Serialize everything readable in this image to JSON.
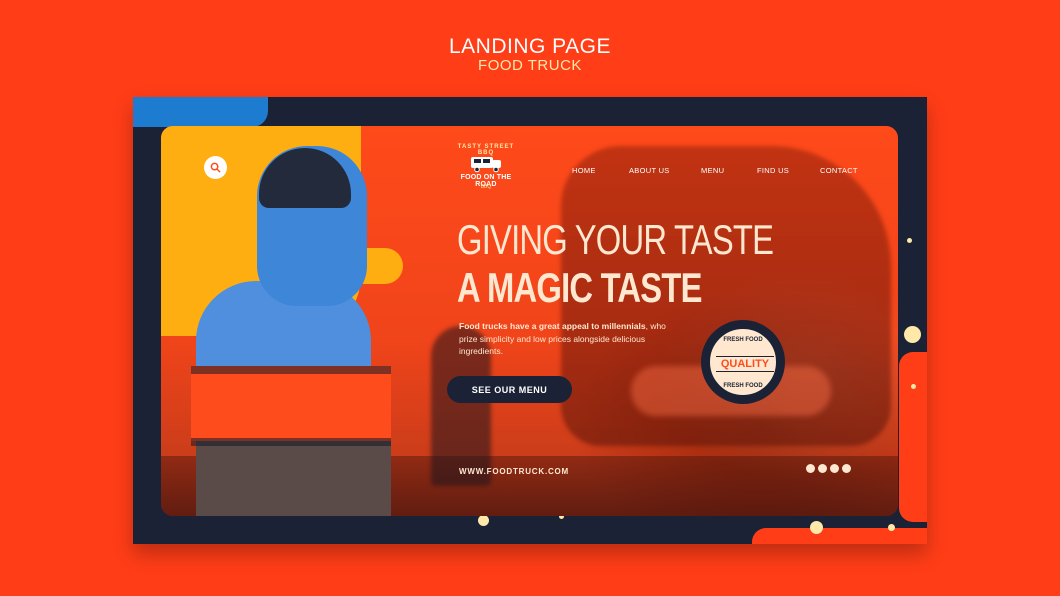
{
  "header": {
    "title": "LANDING PAGE",
    "subtitle": "FOOD TRUCK"
  },
  "logo": {
    "arc": "TASTY STREET BBQ",
    "name": "FOOD ON THE ROAD",
    "sub": "BBQ"
  },
  "nav": {
    "items": [
      "HOME",
      "ABOUT US",
      "MENU",
      "FIND US",
      "CONTACT"
    ]
  },
  "hero": {
    "line1": "GIVING YOUR TASTE",
    "line2": "A MAGIC TASTE",
    "desc_bold": "Food trucks have a great appeal to millennials",
    "desc_rest": ", who prize simplicity and low prices alongside delicious ingredients.",
    "cta": "SEE OUR MENU"
  },
  "badge": {
    "top": "FRESH FOOD",
    "mid": "QUALITY",
    "bottom": "FRESH FOOD"
  },
  "footer": {
    "url": "WWW.FOODTRUCK.COM"
  },
  "social": [
    "instagram-icon",
    "facebook-icon",
    "twitter-icon",
    "whatsapp-icon"
  ],
  "colors": {
    "background": "#ff3d17",
    "dark": "#1b2236",
    "accent_yellow": "#ffae12",
    "accent_blue": "#1d7bd0",
    "cream": "#ffe8cf"
  }
}
